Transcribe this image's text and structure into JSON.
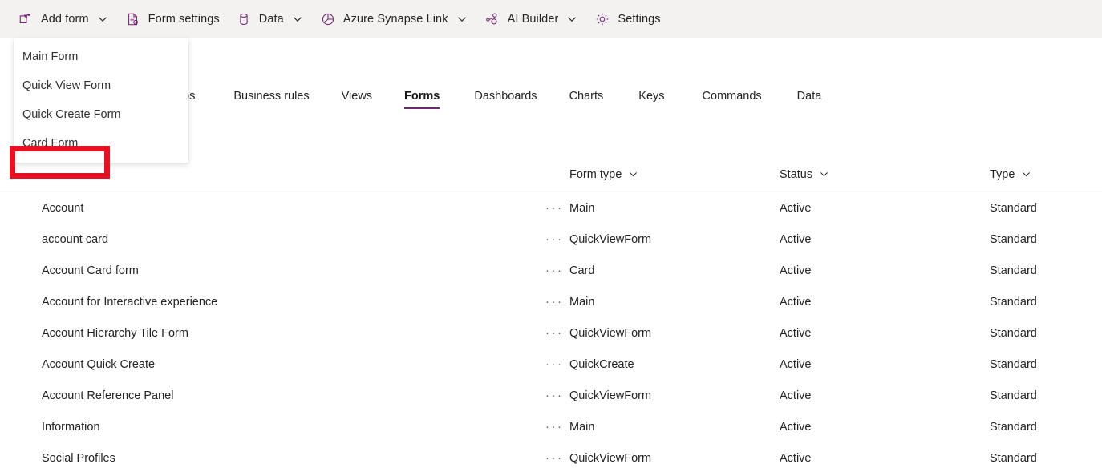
{
  "commandbar": {
    "items": [
      {
        "label": "Add form",
        "icon": "add-form-icon",
        "caret": true
      },
      {
        "label": "Form settings",
        "icon": "form-settings-icon",
        "caret": false
      },
      {
        "label": "Data",
        "icon": "database-icon",
        "caret": true
      },
      {
        "label": "Azure Synapse Link",
        "icon": "azure-synapse-icon",
        "caret": true
      },
      {
        "label": "AI Builder",
        "icon": "ai-builder-icon",
        "caret": true
      },
      {
        "label": "Settings",
        "icon": "gear-icon",
        "caret": false
      }
    ]
  },
  "add_form_menu": {
    "items": [
      {
        "label": "Main Form"
      },
      {
        "label": "Quick View Form"
      },
      {
        "label": "Quick Create Form"
      },
      {
        "label": "Card Form"
      }
    ],
    "highlighted_item": "Card Form"
  },
  "tabs": {
    "items": [
      {
        "label": "ps",
        "selected": false
      },
      {
        "label": "Business rules",
        "selected": false
      },
      {
        "label": "Views",
        "selected": false
      },
      {
        "label": "Forms",
        "selected": true
      },
      {
        "label": "Dashboards",
        "selected": false
      },
      {
        "label": "Charts",
        "selected": false
      },
      {
        "label": "Keys",
        "selected": false
      },
      {
        "label": "Commands",
        "selected": false
      },
      {
        "label": "Data",
        "selected": false
      }
    ]
  },
  "grid": {
    "columns": [
      {
        "label": "",
        "sortable": false
      },
      {
        "label": "Form type",
        "sortable": true
      },
      {
        "label": "Status",
        "sortable": true
      },
      {
        "label": "Type",
        "sortable": true
      }
    ],
    "more_glyph": "···",
    "rows": [
      {
        "name": "Account",
        "form_type": "Main",
        "status": "Active",
        "type": "Standard"
      },
      {
        "name": "account card",
        "form_type": "QuickViewForm",
        "status": "Active",
        "type": "Standard"
      },
      {
        "name": "Account Card form",
        "form_type": "Card",
        "status": "Active",
        "type": "Standard"
      },
      {
        "name": "Account for Interactive experience",
        "form_type": "Main",
        "status": "Active",
        "type": "Standard"
      },
      {
        "name": "Account Hierarchy Tile Form",
        "form_type": "QuickViewForm",
        "status": "Active",
        "type": "Standard"
      },
      {
        "name": "Account Quick Create",
        "form_type": "QuickCreate",
        "status": "Active",
        "type": "Standard"
      },
      {
        "name": "Account Reference Panel",
        "form_type": "QuickViewForm",
        "status": "Active",
        "type": "Standard"
      },
      {
        "name": "Information",
        "form_type": "Main",
        "status": "Active",
        "type": "Standard"
      },
      {
        "name": "Social Profiles",
        "form_type": "QuickViewForm",
        "status": "Active",
        "type": "Standard"
      }
    ]
  },
  "colors": {
    "accent_purple": "#742774",
    "commandbar_bg": "#f3f2f1",
    "highlight_red": "#e81123",
    "text_primary": "#242424",
    "divider": "#edebe9"
  }
}
